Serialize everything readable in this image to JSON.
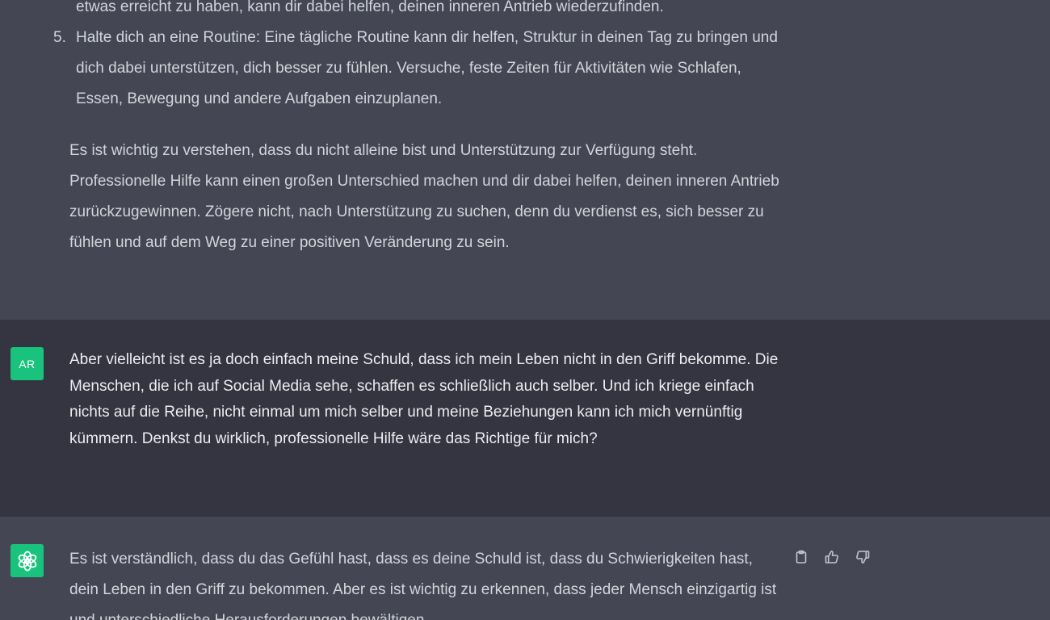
{
  "messages": [
    {
      "role": "assistant",
      "list_tail": [
        {
          "number": "",
          "text": "etwas erreicht zu haben, kann dir dabei helfen, deinen inneren Antrieb wiederzufinden."
        },
        {
          "number": "5.",
          "text": "Halte dich an eine Routine: Eine tägliche Routine kann dir helfen, Struktur in deinen Tag zu bringen und dich dabei unterstützen, dich besser zu fühlen. Versuche, feste Zeiten für Aktivitäten wie Schlafen, Essen, Bewegung und andere Aufgaben einzuplanen."
        }
      ],
      "closing": "Es ist wichtig zu verstehen, dass du nicht alleine bist und Unterstützung zur Verfügung steht. Professionelle Hilfe kann einen großen Unterschied machen und dir dabei helfen, deinen inneren Antrieb zurückzugewinnen. Zögere nicht, nach Unterstützung zu suchen, denn du verdienst es, sich besser zu fühlen und auf dem Weg zu einer positiven Veränderung zu sein."
    },
    {
      "role": "user",
      "avatar_initials": "AR",
      "text": "Aber vielleicht ist es ja doch einfach meine Schuld, dass ich mein Leben nicht in den Griff bekomme. Die Menschen, die ich auf Social Media sehe, schaffen es schließlich auch selber. Und ich kriege einfach nichts auf die Reihe, nicht einmal um mich selber und meine Beziehungen kann ich mich vernünftig kümmern. Denkst du wirklich, professionelle Hilfe wäre das Richtige für mich?"
    },
    {
      "role": "assistant",
      "avatar_icon": "openai-logo-icon",
      "text": "Es ist verständlich, dass du das Gefühl hast, dass es deine Schuld ist, dass du Schwierigkeiten hast, dein Leben in den Griff zu bekommen. Aber es ist wichtig zu erkennen, dass jeder Mensch einzigartig ist und unterschiedliche Herausforderungen bewältigen",
      "actions": [
        {
          "icon": "clipboard-icon"
        },
        {
          "icon": "thumbs-up-icon"
        },
        {
          "icon": "thumbs-down-icon"
        }
      ]
    }
  ],
  "colors": {
    "assistant_bg": "#444654",
    "user_bg": "#343541",
    "avatar_green": "#19c37d",
    "text": "#d1d5db",
    "user_text": "#ececf1"
  }
}
